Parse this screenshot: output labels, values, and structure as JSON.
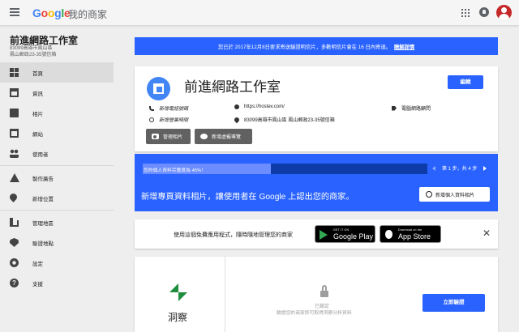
{
  "header": {
    "logo": [
      "G",
      "o",
      "o",
      "g",
      "l",
      "e"
    ],
    "app_title": "我的商家",
    "icons": [
      "menu-icon",
      "apps-icon",
      "notifications-icon",
      "account-avatar"
    ]
  },
  "sidebar": {
    "business_name": "前進網路工作室",
    "address_line1": "83099高雄市鳳山區",
    "address_line2": "鳳山郵政23-35號信箱",
    "items": [
      {
        "label": "首頁",
        "icon": "home-icon",
        "active": true
      },
      {
        "label": "資訊",
        "icon": "store-info-icon"
      },
      {
        "label": "相片",
        "icon": "photos-icon"
      },
      {
        "label": "網站",
        "icon": "website-icon"
      },
      {
        "label": "使用者",
        "icon": "users-icon"
      },
      {
        "label": "製作廣告",
        "icon": "adwords-icon"
      },
      {
        "label": "新增位置",
        "icon": "location-icon"
      },
      {
        "label": "管理地區",
        "icon": "manage-locations-icon"
      },
      {
        "label": "聯證地點",
        "icon": "linked-accounts-icon"
      },
      {
        "label": "設定",
        "icon": "settings-icon"
      },
      {
        "label": "支援",
        "icon": "help-icon"
      }
    ]
  },
  "banner": {
    "text": "您已於 2017年12月8日要求寄送驗證明信片，多數明信片會在 16 日內寄達。",
    "link": "瞭解詳情"
  },
  "profile": {
    "title": "前進網路工作室",
    "edit_label": "編輯",
    "phone_label": "新增電話號碼",
    "hours_label": "新增營業時間",
    "website": "https://hostev.com/",
    "address": "83099高雄市鳳山區 鳳山郵政23-35號信箱",
    "category": "電腦網路顧問",
    "manage_photos_label": "管理相片",
    "add_tour_label": "新增虛擬導覽"
  },
  "progress": {
    "label": "您的個人資料完整度為 45%！",
    "percent": 45,
    "step_text": "第 1 步，共 4 步",
    "message": "新增專頁資料相片，讓使用者在 Google 上認出您的商家。",
    "button_label": "新增個人資料相片"
  },
  "app_promo": {
    "text": "使用這個免費應用程式，隨時隨地管理您的商家",
    "google_play_small": "GET IT ON",
    "google_play_big": "Google Play",
    "app_store_small": "Download on the",
    "app_store_big": "App Store",
    "close": "✕"
  },
  "insights": {
    "title": "洞察",
    "locked_label": "已鎖定",
    "locked_desc": "驗證您的商家即可取得洞察分析資料",
    "verify_label": "立即驗證"
  }
}
